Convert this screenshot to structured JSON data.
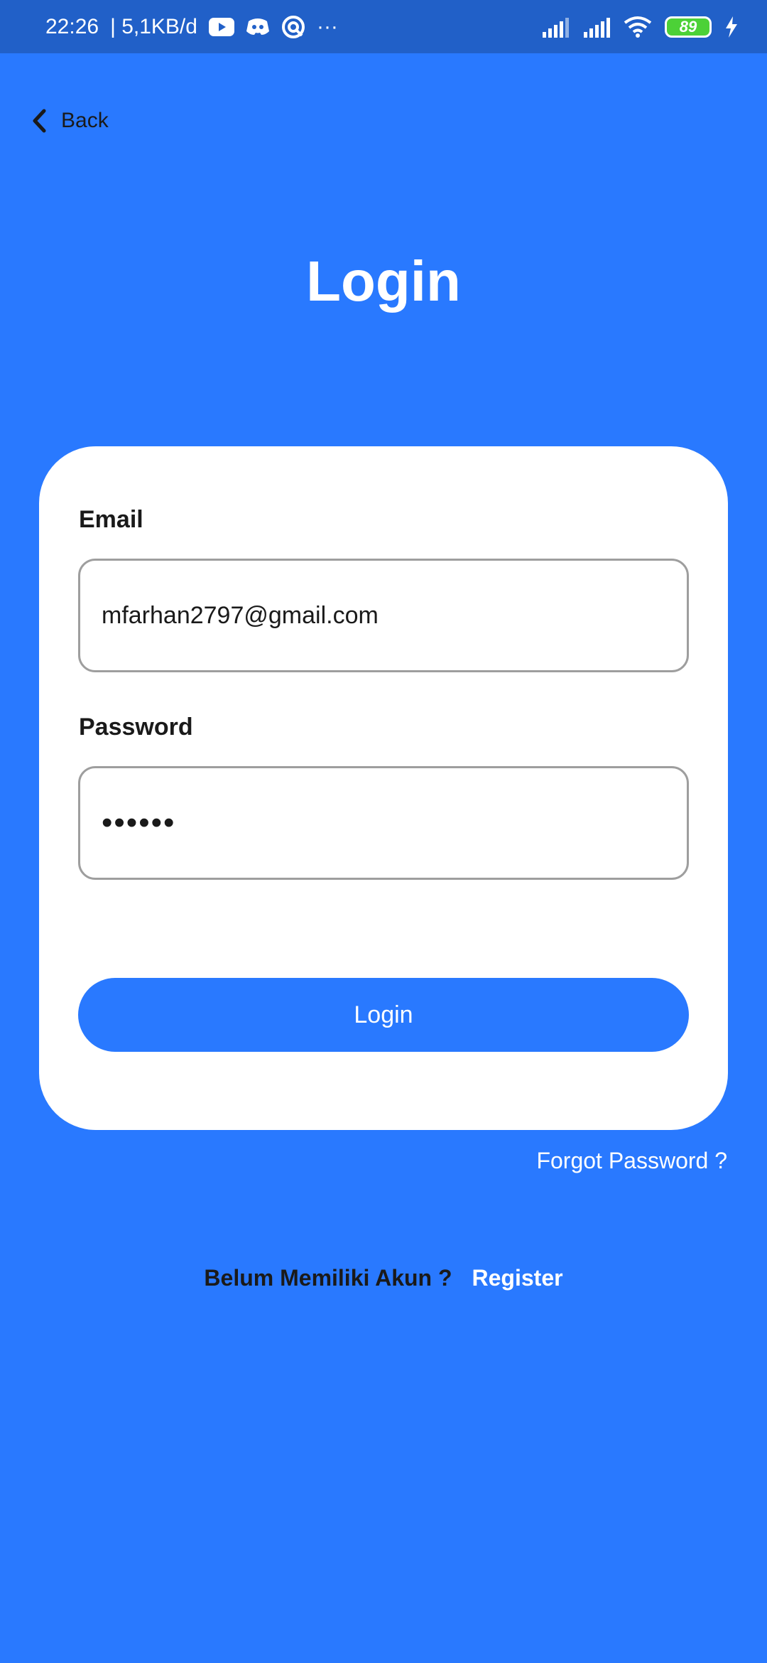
{
  "status_bar": {
    "time": "22:26",
    "network_speed": "| 5,1KB/d",
    "more": "···",
    "battery_level": "89",
    "icons": [
      "youtube-icon",
      "discord-icon",
      "circle-app-icon",
      "signal-icon",
      "signal-icon",
      "wifi-icon",
      "battery-icon",
      "charging-icon"
    ]
  },
  "nav": {
    "back_label": "Back"
  },
  "page": {
    "title": "Login"
  },
  "form": {
    "email_label": "Email",
    "email_value": "mfarhan2797@gmail.com",
    "password_label": "Password",
    "password_value": "••••••",
    "login_button": "Login"
  },
  "links": {
    "forgot_password": "Forgot Password ?",
    "register_prompt": "Belum Memiliki Akun ?",
    "register": "Register"
  },
  "colors": {
    "background": "#2979FF",
    "status_bar": "#2160C8",
    "card": "#FFFFFF",
    "button": "#2979FF",
    "battery": "#4CD137"
  }
}
